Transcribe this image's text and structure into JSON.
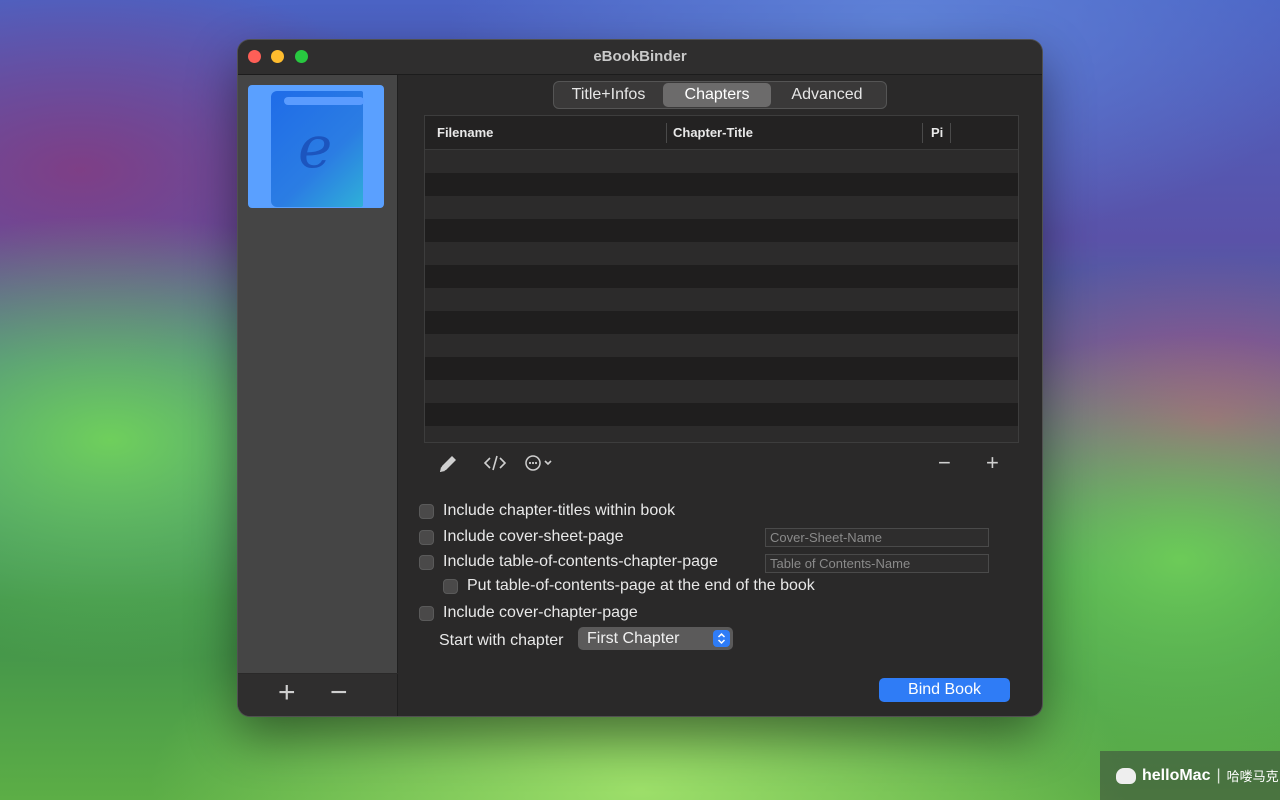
{
  "window": {
    "title": "eBookBinder"
  },
  "sidebar": {
    "add_symbol": "+",
    "remove_symbol": "−",
    "cover_letter": "e"
  },
  "tabs": [
    {
      "label": "Title+Infos",
      "selected": false
    },
    {
      "label": "Chapters",
      "selected": true
    },
    {
      "label": "Advanced",
      "selected": false
    }
  ],
  "table": {
    "columns": [
      "Filename",
      "Chapter-Title",
      "Pi"
    ],
    "rows": []
  },
  "table_toolbar": {
    "edit_icon": "pencil-icon",
    "code_icon": "code-icon",
    "more_icon": "ellipsis-circle-icon",
    "remove_symbol": "−",
    "add_symbol": "+"
  },
  "options": {
    "include_chapter_titles": {
      "label": "Include chapter-titles within book",
      "checked": false
    },
    "include_cover_sheet": {
      "label": "Include cover-sheet-page",
      "checked": false,
      "name_placeholder": "Cover-Sheet-Name"
    },
    "include_toc": {
      "label": "Include table-of-contents-chapter-page",
      "checked": false,
      "name_placeholder": "Table of Contents-Name"
    },
    "toc_at_end": {
      "label": "Put table-of-contents-page at the end of the book",
      "checked": false
    },
    "include_cover_chapter": {
      "label": "Include cover-chapter-page",
      "checked": false
    }
  },
  "start_with_chapter": {
    "label": "Start with chapter",
    "value": "First Chapter"
  },
  "bind_button": {
    "label": "Bind Book"
  },
  "watermark": {
    "brand": "helloMac",
    "separator": "|",
    "chinese": "哈喽马克"
  },
  "colors": {
    "accent": "#2f7cf6",
    "window_bg": "#2a2929"
  }
}
